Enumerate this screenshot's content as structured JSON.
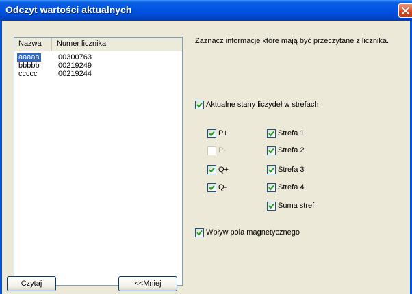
{
  "window": {
    "title": "Odczyt wartości aktualnych"
  },
  "list": {
    "columns": [
      "Nazwa",
      "Numer licznika"
    ],
    "rows": [
      {
        "name": "aaaaa",
        "number": "00300763",
        "selected": true
      },
      {
        "name": "bbbbb",
        "number": "00219249",
        "selected": false
      },
      {
        "name": "ccccc",
        "number": "00219244",
        "selected": false
      }
    ]
  },
  "buttons": {
    "read": "Czytaj",
    "less": "<<Mniej"
  },
  "instruction": "Zaznacz informacje które mają być przeczytane z licznika.",
  "options": {
    "current_states": {
      "label": "Aktualne stany liczydeł w strefach",
      "checked": true
    },
    "p_plus": {
      "label": "P+",
      "checked": true
    },
    "p_minus": {
      "label": "P-",
      "checked": false,
      "disabled": true
    },
    "q_plus": {
      "label": "Q+",
      "checked": true
    },
    "q_minus": {
      "label": "Q-",
      "checked": true
    },
    "zone1": {
      "label": "Strefa 1",
      "checked": true
    },
    "zone2": {
      "label": "Strefa 2",
      "checked": true
    },
    "zone3": {
      "label": "Strefa 3",
      "checked": true
    },
    "zone4": {
      "label": "Strefa 4",
      "checked": true
    },
    "zone_sum": {
      "label": "Suma stref",
      "checked": true
    },
    "magnetic": {
      "label": "Wpływ pola magnetycznego",
      "checked": true
    }
  },
  "colors": {
    "titlebar": "#0054e3",
    "selection": "#316ac5",
    "check": "#21a121",
    "dialog_bg": "#ece9d8"
  }
}
